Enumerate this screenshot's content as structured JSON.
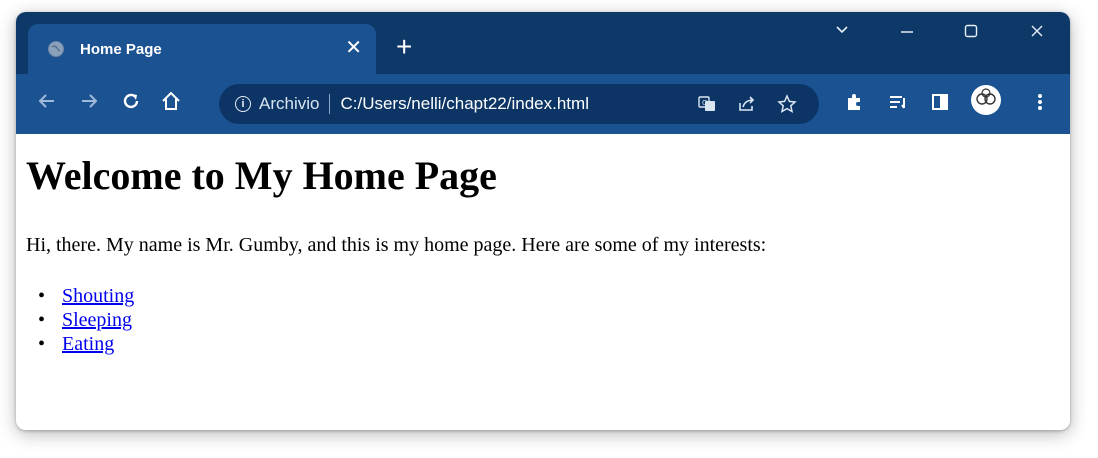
{
  "browser": {
    "tab": {
      "title": "Home Page",
      "close": "✕"
    },
    "new_tab": "+",
    "window_controls": {
      "tab_search": "⌄",
      "minimize": "—",
      "maximize": "☐",
      "close": "✕"
    },
    "address_bar": {
      "secure_label": "Archivio",
      "url": "C:/Users/nelli/chapt22/index.html"
    },
    "icons": {
      "back": "back-arrow-icon",
      "forward": "forward-arrow-icon",
      "reload": "reload-icon",
      "home": "home-icon",
      "info": "info-icon",
      "translate": "translate-icon",
      "share": "share-icon",
      "bookmark": "star-icon",
      "extensions": "puzzle-icon",
      "reading_list": "reading-list-icon",
      "side_panel": "side-panel-icon",
      "profile": "profile-avatar-icon",
      "menu": "more-vert-icon"
    },
    "colors": {
      "tabstrip": "#0d3868",
      "toolbar": "#1b5292",
      "omnibox": "#0c3565"
    }
  },
  "page": {
    "heading": "Welcome to My Home Page",
    "intro": "Hi, there. My name is Mr. Gumby, and this is my home page. Here are some of my interests:",
    "interests": [
      "Shouting",
      "Sleeping",
      "Eating"
    ]
  }
}
